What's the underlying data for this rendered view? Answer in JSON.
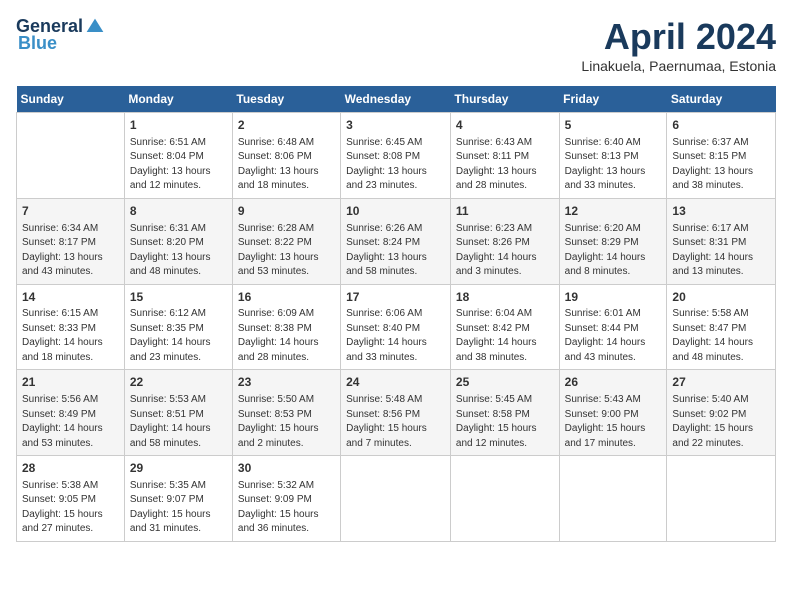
{
  "header": {
    "logo_general": "General",
    "logo_blue": "Blue",
    "month": "April 2024",
    "location": "Linakuela, Paernumaa, Estonia"
  },
  "days_of_week": [
    "Sunday",
    "Monday",
    "Tuesday",
    "Wednesday",
    "Thursday",
    "Friday",
    "Saturday"
  ],
  "weeks": [
    [
      {
        "day": "",
        "info": ""
      },
      {
        "day": "1",
        "info": "Sunrise: 6:51 AM\nSunset: 8:04 PM\nDaylight: 13 hours\nand 12 minutes."
      },
      {
        "day": "2",
        "info": "Sunrise: 6:48 AM\nSunset: 8:06 PM\nDaylight: 13 hours\nand 18 minutes."
      },
      {
        "day": "3",
        "info": "Sunrise: 6:45 AM\nSunset: 8:08 PM\nDaylight: 13 hours\nand 23 minutes."
      },
      {
        "day": "4",
        "info": "Sunrise: 6:43 AM\nSunset: 8:11 PM\nDaylight: 13 hours\nand 28 minutes."
      },
      {
        "day": "5",
        "info": "Sunrise: 6:40 AM\nSunset: 8:13 PM\nDaylight: 13 hours\nand 33 minutes."
      },
      {
        "day": "6",
        "info": "Sunrise: 6:37 AM\nSunset: 8:15 PM\nDaylight: 13 hours\nand 38 minutes."
      }
    ],
    [
      {
        "day": "7",
        "info": "Sunrise: 6:34 AM\nSunset: 8:17 PM\nDaylight: 13 hours\nand 43 minutes."
      },
      {
        "day": "8",
        "info": "Sunrise: 6:31 AM\nSunset: 8:20 PM\nDaylight: 13 hours\nand 48 minutes."
      },
      {
        "day": "9",
        "info": "Sunrise: 6:28 AM\nSunset: 8:22 PM\nDaylight: 13 hours\nand 53 minutes."
      },
      {
        "day": "10",
        "info": "Sunrise: 6:26 AM\nSunset: 8:24 PM\nDaylight: 13 hours\nand 58 minutes."
      },
      {
        "day": "11",
        "info": "Sunrise: 6:23 AM\nSunset: 8:26 PM\nDaylight: 14 hours\nand 3 minutes."
      },
      {
        "day": "12",
        "info": "Sunrise: 6:20 AM\nSunset: 8:29 PM\nDaylight: 14 hours\nand 8 minutes."
      },
      {
        "day": "13",
        "info": "Sunrise: 6:17 AM\nSunset: 8:31 PM\nDaylight: 14 hours\nand 13 minutes."
      }
    ],
    [
      {
        "day": "14",
        "info": "Sunrise: 6:15 AM\nSunset: 8:33 PM\nDaylight: 14 hours\nand 18 minutes."
      },
      {
        "day": "15",
        "info": "Sunrise: 6:12 AM\nSunset: 8:35 PM\nDaylight: 14 hours\nand 23 minutes."
      },
      {
        "day": "16",
        "info": "Sunrise: 6:09 AM\nSunset: 8:38 PM\nDaylight: 14 hours\nand 28 minutes."
      },
      {
        "day": "17",
        "info": "Sunrise: 6:06 AM\nSunset: 8:40 PM\nDaylight: 14 hours\nand 33 minutes."
      },
      {
        "day": "18",
        "info": "Sunrise: 6:04 AM\nSunset: 8:42 PM\nDaylight: 14 hours\nand 38 minutes."
      },
      {
        "day": "19",
        "info": "Sunrise: 6:01 AM\nSunset: 8:44 PM\nDaylight: 14 hours\nand 43 minutes."
      },
      {
        "day": "20",
        "info": "Sunrise: 5:58 AM\nSunset: 8:47 PM\nDaylight: 14 hours\nand 48 minutes."
      }
    ],
    [
      {
        "day": "21",
        "info": "Sunrise: 5:56 AM\nSunset: 8:49 PM\nDaylight: 14 hours\nand 53 minutes."
      },
      {
        "day": "22",
        "info": "Sunrise: 5:53 AM\nSunset: 8:51 PM\nDaylight: 14 hours\nand 58 minutes."
      },
      {
        "day": "23",
        "info": "Sunrise: 5:50 AM\nSunset: 8:53 PM\nDaylight: 15 hours\nand 2 minutes."
      },
      {
        "day": "24",
        "info": "Sunrise: 5:48 AM\nSunset: 8:56 PM\nDaylight: 15 hours\nand 7 minutes."
      },
      {
        "day": "25",
        "info": "Sunrise: 5:45 AM\nSunset: 8:58 PM\nDaylight: 15 hours\nand 12 minutes."
      },
      {
        "day": "26",
        "info": "Sunrise: 5:43 AM\nSunset: 9:00 PM\nDaylight: 15 hours\nand 17 minutes."
      },
      {
        "day": "27",
        "info": "Sunrise: 5:40 AM\nSunset: 9:02 PM\nDaylight: 15 hours\nand 22 minutes."
      }
    ],
    [
      {
        "day": "28",
        "info": "Sunrise: 5:38 AM\nSunset: 9:05 PM\nDaylight: 15 hours\nand 27 minutes."
      },
      {
        "day": "29",
        "info": "Sunrise: 5:35 AM\nSunset: 9:07 PM\nDaylight: 15 hours\nand 31 minutes."
      },
      {
        "day": "30",
        "info": "Sunrise: 5:32 AM\nSunset: 9:09 PM\nDaylight: 15 hours\nand 36 minutes."
      },
      {
        "day": "",
        "info": ""
      },
      {
        "day": "",
        "info": ""
      },
      {
        "day": "",
        "info": ""
      },
      {
        "day": "",
        "info": ""
      }
    ]
  ]
}
